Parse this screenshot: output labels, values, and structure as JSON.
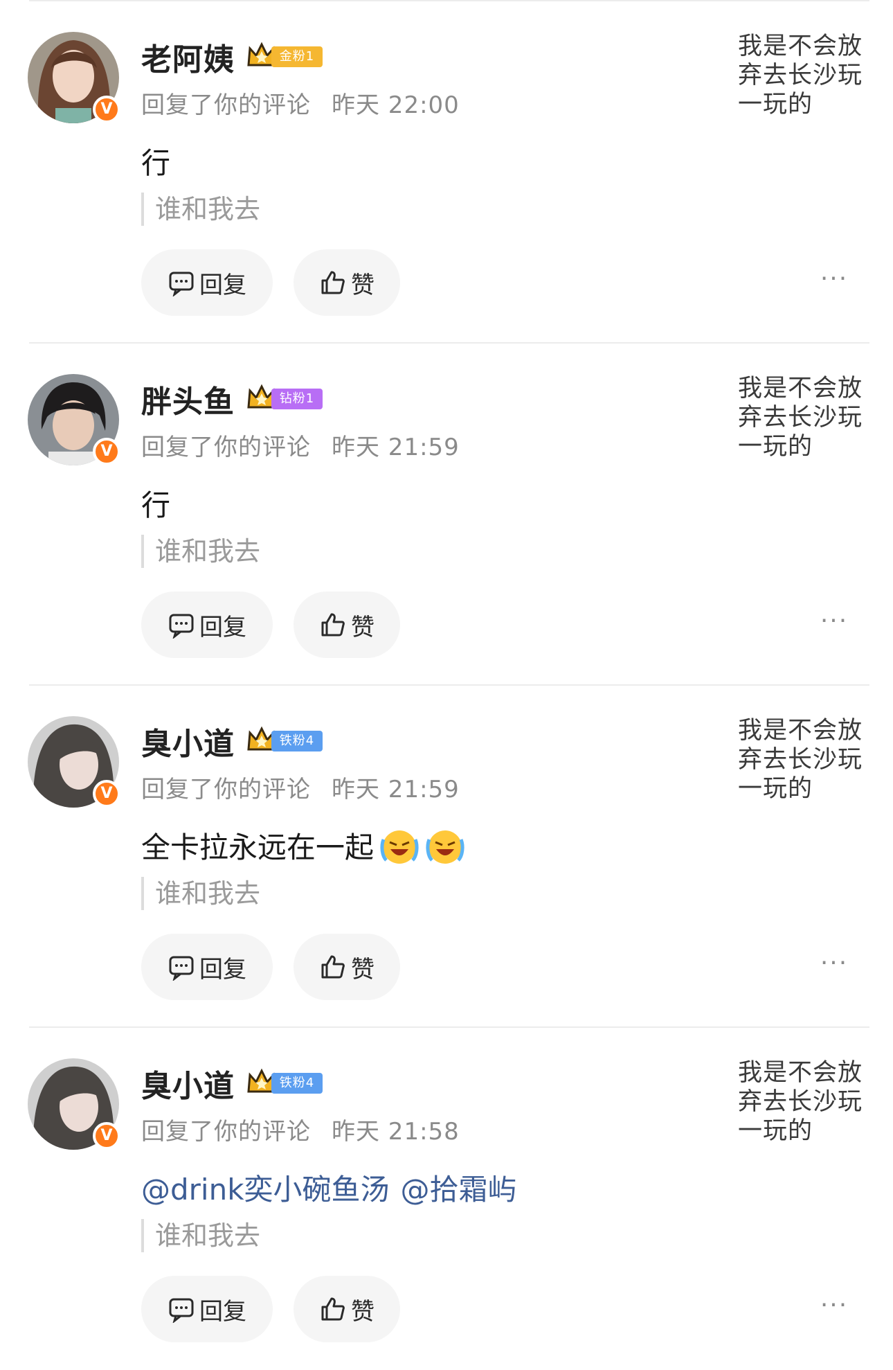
{
  "comments": [
    {
      "username": "老阿姨",
      "fan_badge": {
        "label": "金粉1",
        "color": "#f5b731"
      },
      "action": "回复了你的评论",
      "time": "昨天 22:00",
      "text": "行",
      "quote": "谁和我去",
      "reply_label": "回复",
      "like_label": "赞",
      "original_post": "我是不会放弃去长沙玩一玩的"
    },
    {
      "username": "胖头鱼",
      "fan_badge": {
        "label": "钻粉1",
        "color": "#b86ef5"
      },
      "action": "回复了你的评论",
      "time": "昨天 21:59",
      "text": "行",
      "quote": "谁和我去",
      "reply_label": "回复",
      "like_label": "赞",
      "original_post": "我是不会放弃去长沙玩一玩的"
    },
    {
      "username": "臭小道",
      "fan_badge": {
        "label": "铁粉4",
        "color": "#5b9ef0"
      },
      "action": "回复了你的评论",
      "time": "昨天 21:59",
      "text": "全卡拉永远在一起",
      "text_emoji": [
        "laughing-tears-emoji",
        "laughing-tears-emoji"
      ],
      "quote": "谁和我去",
      "reply_label": "回复",
      "like_label": "赞",
      "original_post": "我是不会放弃去长沙玩一玩的"
    },
    {
      "username": "臭小道",
      "fan_badge": {
        "label": "铁粉4",
        "color": "#5b9ef0"
      },
      "action": "回复了你的评论",
      "time": "昨天 21:58",
      "mentions": [
        "@drink奕小碗鱼汤",
        "@拾霜屿"
      ],
      "quote": "谁和我去",
      "reply_label": "回复",
      "like_label": "赞",
      "original_post": "我是不会放弃去长沙玩一玩的"
    }
  ],
  "verified_badge": "V",
  "more_icon": "···",
  "colors": {
    "mention": "#3d5d95",
    "verified": "#ff7a1a",
    "pill_bg": "#f5f5f5"
  }
}
